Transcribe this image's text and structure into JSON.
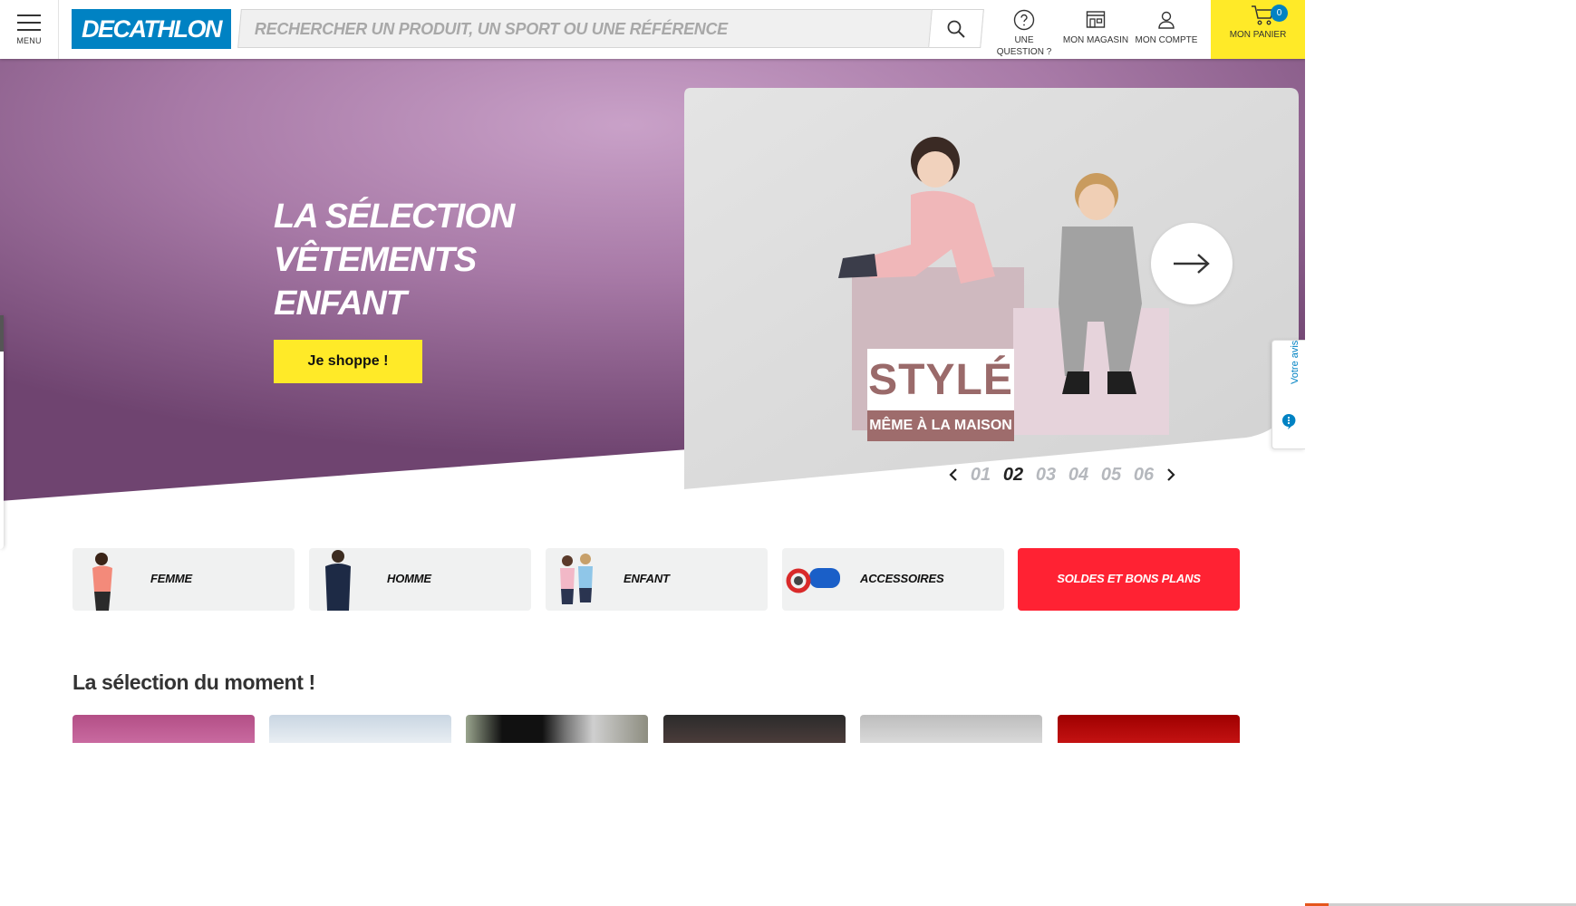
{
  "header": {
    "menu_label": "MENU",
    "logo_text": "DECATHLON",
    "search_placeholder": "RECHERCHER UN PRODUIT, UN SPORT OU UNE RÉFÉRENCE",
    "links": [
      {
        "label": "UNE QUESTION ?",
        "icon": "question-icon"
      },
      {
        "label": "MON MAGASIN",
        "icon": "store-icon"
      },
      {
        "label": "MON COMPTE",
        "icon": "user-icon"
      }
    ],
    "cart": {
      "label": "MON PANIER",
      "count": "0",
      "icon": "cart-icon"
    }
  },
  "hero": {
    "title_lines": [
      "LA SÉLECTION",
      "VÊTEMENTS",
      "ENFANT"
    ],
    "cta": "Je shoppe !",
    "stamp_main": "STYLÉ",
    "stamp_sub": "MÊME À LA MAISON",
    "pages": [
      "01",
      "02",
      "03",
      "04",
      "05",
      "06"
    ],
    "active_page": "02"
  },
  "feedback_tab": {
    "label": "Votre avis"
  },
  "categories": [
    {
      "label": "FEMME"
    },
    {
      "label": "HOMME"
    },
    {
      "label": "ENFANT"
    },
    {
      "label": "ACCESSOIRES"
    },
    {
      "label": "SOLDES ET BONS PLANS"
    }
  ],
  "selection": {
    "title": "La sélection du moment !"
  },
  "colors": {
    "brand_blue": "#0082c3",
    "yellow": "#ffea28",
    "sale_red": "#ff2233",
    "hero_purple": "#9b6a9a"
  }
}
